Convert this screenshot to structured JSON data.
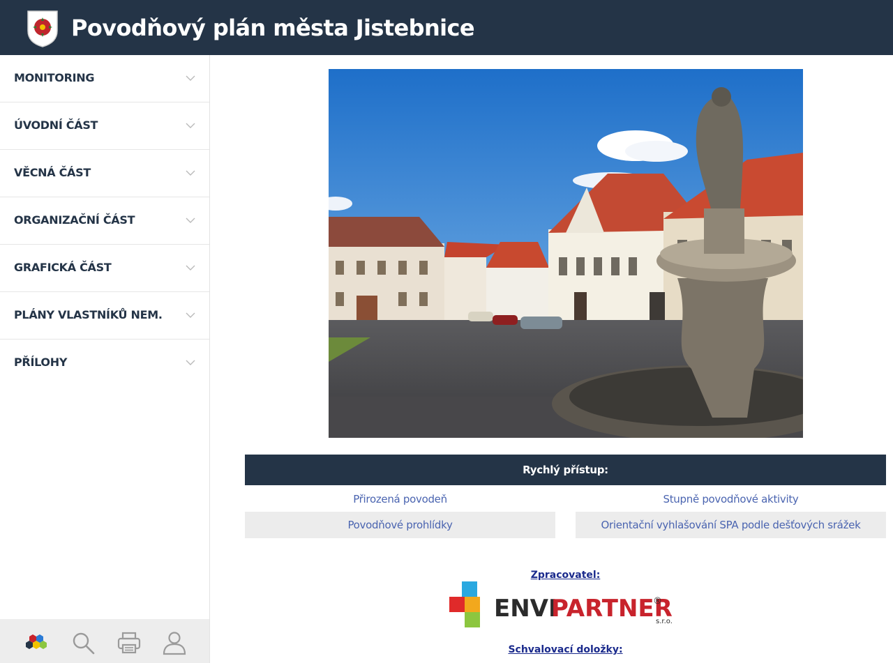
{
  "header": {
    "title": "Povodňový plán města Jistebnice"
  },
  "sidebar": {
    "items": [
      {
        "label": "MONITORING"
      },
      {
        "label": "ÚVODNÍ ČÁST"
      },
      {
        "label": "VĚCNÁ ČÁST"
      },
      {
        "label": "ORGANIZAČNÍ ČÁST"
      },
      {
        "label": "GRAFICKÁ ČÁST"
      },
      {
        "label": "PLÁNY VLASTNÍKŮ NEM."
      },
      {
        "label": "PŘÍLOHY"
      }
    ],
    "toolbar": [
      "envipartner-icon",
      "search-icon",
      "print-icon",
      "user-icon"
    ]
  },
  "quick_access": {
    "title": "Rychlý přístup:",
    "links": [
      "Přirozená povodeň",
      "Stupně povodňové aktivity",
      "Povodňové prohlídky",
      "Orientační vyhlašování SPA podle dešťových srážek"
    ]
  },
  "footer": {
    "processor_label": "Zpracovatel:",
    "logo_text_1": "ENVI",
    "logo_text_2": "PARTNER",
    "logo_suffix": "s.r.o.",
    "logo_reg": "®",
    "approval_label": "Schvalovací doložky:"
  },
  "colors": {
    "header_bg": "#243447",
    "link": "#4a64b0",
    "caption_link": "#1a2a8c",
    "logo_red": "#c8232c"
  }
}
